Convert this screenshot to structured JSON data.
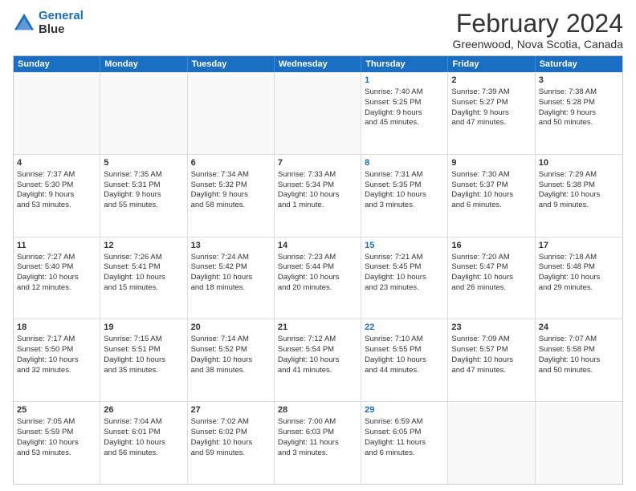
{
  "logo": {
    "line1": "General",
    "line2": "Blue"
  },
  "title": "February 2024",
  "subtitle": "Greenwood, Nova Scotia, Canada",
  "days": [
    "Sunday",
    "Monday",
    "Tuesday",
    "Wednesday",
    "Thursday",
    "Friday",
    "Saturday"
  ],
  "rows": [
    [
      {
        "day": "",
        "info": ""
      },
      {
        "day": "",
        "info": ""
      },
      {
        "day": "",
        "info": ""
      },
      {
        "day": "",
        "info": ""
      },
      {
        "day": "1",
        "info": "Sunrise: 7:40 AM\nSunset: 5:25 PM\nDaylight: 9 hours\nand 45 minutes."
      },
      {
        "day": "2",
        "info": "Sunrise: 7:39 AM\nSunset: 5:27 PM\nDaylight: 9 hours\nand 47 minutes."
      },
      {
        "day": "3",
        "info": "Sunrise: 7:38 AM\nSunset: 5:28 PM\nDaylight: 9 hours\nand 50 minutes."
      }
    ],
    [
      {
        "day": "4",
        "info": "Sunrise: 7:37 AM\nSunset: 5:30 PM\nDaylight: 9 hours\nand 53 minutes."
      },
      {
        "day": "5",
        "info": "Sunrise: 7:35 AM\nSunset: 5:31 PM\nDaylight: 9 hours\nand 55 minutes."
      },
      {
        "day": "6",
        "info": "Sunrise: 7:34 AM\nSunset: 5:32 PM\nDaylight: 9 hours\nand 58 minutes."
      },
      {
        "day": "7",
        "info": "Sunrise: 7:33 AM\nSunset: 5:34 PM\nDaylight: 10 hours\nand 1 minute."
      },
      {
        "day": "8",
        "info": "Sunrise: 7:31 AM\nSunset: 5:35 PM\nDaylight: 10 hours\nand 3 minutes."
      },
      {
        "day": "9",
        "info": "Sunrise: 7:30 AM\nSunset: 5:37 PM\nDaylight: 10 hours\nand 6 minutes."
      },
      {
        "day": "10",
        "info": "Sunrise: 7:29 AM\nSunset: 5:38 PM\nDaylight: 10 hours\nand 9 minutes."
      }
    ],
    [
      {
        "day": "11",
        "info": "Sunrise: 7:27 AM\nSunset: 5:40 PM\nDaylight: 10 hours\nand 12 minutes."
      },
      {
        "day": "12",
        "info": "Sunrise: 7:26 AM\nSunset: 5:41 PM\nDaylight: 10 hours\nand 15 minutes."
      },
      {
        "day": "13",
        "info": "Sunrise: 7:24 AM\nSunset: 5:42 PM\nDaylight: 10 hours\nand 18 minutes."
      },
      {
        "day": "14",
        "info": "Sunrise: 7:23 AM\nSunset: 5:44 PM\nDaylight: 10 hours\nand 20 minutes."
      },
      {
        "day": "15",
        "info": "Sunrise: 7:21 AM\nSunset: 5:45 PM\nDaylight: 10 hours\nand 23 minutes."
      },
      {
        "day": "16",
        "info": "Sunrise: 7:20 AM\nSunset: 5:47 PM\nDaylight: 10 hours\nand 26 minutes."
      },
      {
        "day": "17",
        "info": "Sunrise: 7:18 AM\nSunset: 5:48 PM\nDaylight: 10 hours\nand 29 minutes."
      }
    ],
    [
      {
        "day": "18",
        "info": "Sunrise: 7:17 AM\nSunset: 5:50 PM\nDaylight: 10 hours\nand 32 minutes."
      },
      {
        "day": "19",
        "info": "Sunrise: 7:15 AM\nSunset: 5:51 PM\nDaylight: 10 hours\nand 35 minutes."
      },
      {
        "day": "20",
        "info": "Sunrise: 7:14 AM\nSunset: 5:52 PM\nDaylight: 10 hours\nand 38 minutes."
      },
      {
        "day": "21",
        "info": "Sunrise: 7:12 AM\nSunset: 5:54 PM\nDaylight: 10 hours\nand 41 minutes."
      },
      {
        "day": "22",
        "info": "Sunrise: 7:10 AM\nSunset: 5:55 PM\nDaylight: 10 hours\nand 44 minutes."
      },
      {
        "day": "23",
        "info": "Sunrise: 7:09 AM\nSunset: 5:57 PM\nDaylight: 10 hours\nand 47 minutes."
      },
      {
        "day": "24",
        "info": "Sunrise: 7:07 AM\nSunset: 5:58 PM\nDaylight: 10 hours\nand 50 minutes."
      }
    ],
    [
      {
        "day": "25",
        "info": "Sunrise: 7:05 AM\nSunset: 5:59 PM\nDaylight: 10 hours\nand 53 minutes."
      },
      {
        "day": "26",
        "info": "Sunrise: 7:04 AM\nSunset: 6:01 PM\nDaylight: 10 hours\nand 56 minutes."
      },
      {
        "day": "27",
        "info": "Sunrise: 7:02 AM\nSunset: 6:02 PM\nDaylight: 10 hours\nand 59 minutes."
      },
      {
        "day": "28",
        "info": "Sunrise: 7:00 AM\nSunset: 6:03 PM\nDaylight: 11 hours\nand 3 minutes."
      },
      {
        "day": "29",
        "info": "Sunrise: 6:59 AM\nSunset: 6:05 PM\nDaylight: 11 hours\nand 6 minutes."
      },
      {
        "day": "",
        "info": ""
      },
      {
        "day": "",
        "info": ""
      }
    ]
  ]
}
